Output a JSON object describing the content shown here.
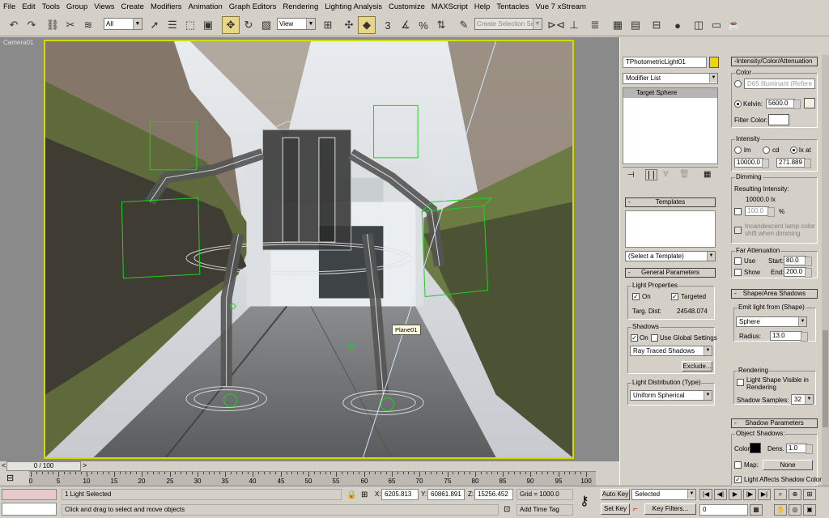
{
  "menu": [
    "File",
    "Edit",
    "Tools",
    "Group",
    "Views",
    "Create",
    "Modifiers",
    "Animation",
    "Graph Editors",
    "Rendering",
    "Lighting Analysis",
    "Customize",
    "MAXScript",
    "Help",
    "Tentacles",
    "Vue 7 xStream"
  ],
  "toolbar": {
    "filter": "All",
    "ref_coord": "View",
    "selection_set": "Create Selection Set"
  },
  "viewport": {
    "label": "Camera01",
    "tooltip": "Plane01"
  },
  "modify": {
    "object_name": "TPhotometricLight01",
    "object_color": "#f0d400",
    "modifier_list": "Modifier List",
    "stack_item": "Target Sphere"
  },
  "templates": {
    "title": "Templates",
    "select": "(Select a Template)"
  },
  "general": {
    "title": "General Parameters",
    "light_props": "Light Properties",
    "on": "On",
    "targeted": "Targeted",
    "targ_dist_label": "Targ. Dist:",
    "targ_dist": "24548.074",
    "shadows": "Shadows",
    "shadow_on": "On",
    "use_global": "Use Global Settings",
    "shadow_type": "Ray Traced Shadows",
    "exclude": "Exclude...",
    "dist_title": "Light Distribution (Type)",
    "dist": "Uniform Spherical"
  },
  "intensity": {
    "title": "Intensity/Color/Attenuation",
    "color": "Color",
    "preset": "D65 Illuminant (Refere",
    "kelvin_label": "Kelvin:",
    "kelvin": "5600.0",
    "kelvin_color": "#f7ece0",
    "filter_label": "Filter Color:",
    "filter_color": "#ffffff",
    "intensity": "Intensity",
    "lm": "lm",
    "cd": "cd",
    "lx": "lx at",
    "intensity_val": "10000.0",
    "lx_dist": "271.889",
    "dimming": "Dimming",
    "resulting": "Resulting Intensity:",
    "resulting_val": "10000.0 lx",
    "dim_pct": "100.0",
    "pct": "%",
    "incand": "Incandescent lamp color shift when dimming",
    "far": "Far Attenuation",
    "use": "Use",
    "show": "Show",
    "start_label": "Start:",
    "start": "80.0",
    "end_label": "End:",
    "end": "200.0"
  },
  "shape": {
    "title": "Shape/Area Shadows",
    "emit": "Emit light from (Shape)",
    "shape": "Sphere",
    "radius_label": "Radius:",
    "radius": "13.0",
    "rendering": "Rendering",
    "visible": "Light Shape Visible in Rendering",
    "samples_label": "Shadow Samples:",
    "samples": "32"
  },
  "shadowp": {
    "title": "Shadow Parameters",
    "object_shadows": "Object Shadows:",
    "color_label": "Color:",
    "dens_label": "Dens.",
    "dens": "1.0",
    "map": "Map:",
    "map_val": "None",
    "affects": "Light Affects Shadow Color"
  },
  "timeline": {
    "frame": "0 / 100",
    "ticks": [
      "0",
      "5",
      "10",
      "15",
      "20",
      "25",
      "30",
      "35",
      "40",
      "45",
      "50",
      "55",
      "60",
      "65",
      "70",
      "75",
      "80",
      "85",
      "90",
      "95",
      "100"
    ]
  },
  "status": {
    "selected": "1 Light Selected",
    "prompt": "Click and drag to select and move objects",
    "x_label": "X:",
    "x": "6205.813",
    "y_label": "Y:",
    "y": "60861.891",
    "z_label": "Z:",
    "z": "15256.452",
    "grid": "Grid = 1000.0",
    "add_time_tag": "Add Time Tag",
    "auto_key": "Auto Key",
    "set_key": "Set Key",
    "key_mode": "Selected",
    "key_filters": "Key Filters...",
    "frame_field": "0"
  }
}
